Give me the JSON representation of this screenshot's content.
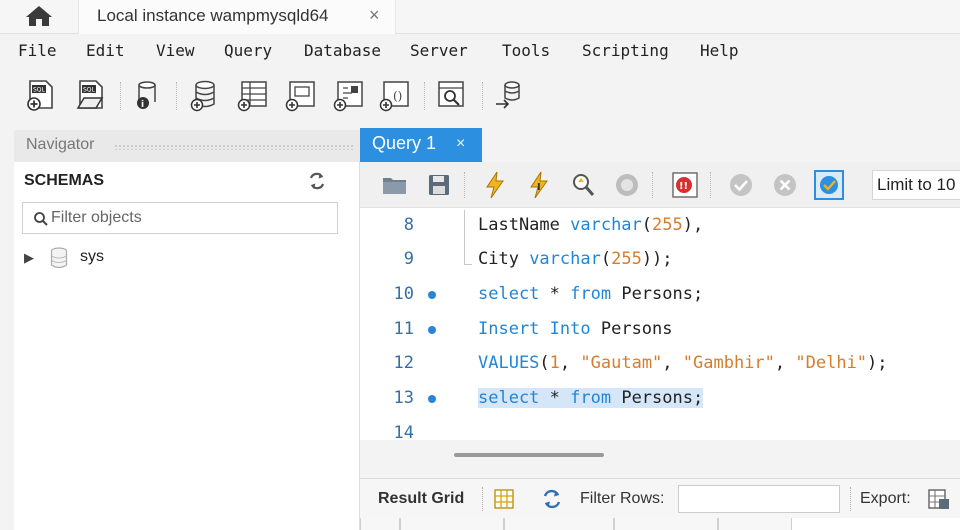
{
  "connection_tab": {
    "title": "Local instance wampmysqld64",
    "close": "×"
  },
  "menu": [
    "File",
    "Edit",
    "View",
    "Query",
    "Database",
    "Server",
    "Tools",
    "Scripting",
    "Help"
  ],
  "navigator": {
    "title": "Navigator",
    "schemas_label": "SCHEMAS",
    "filter_placeholder": "Filter objects",
    "schemas": [
      {
        "name": "sys",
        "expanded": false
      }
    ]
  },
  "query_tab": {
    "label": "Query 1",
    "close": "×"
  },
  "query_toolbar": {
    "limit_label": "Limit to 10"
  },
  "editor": {
    "lines": [
      {
        "n": "8",
        "text": "LastName varchar(255),",
        "breakpoint": false,
        "selected": false
      },
      {
        "n": "9",
        "text": "City varchar(255));",
        "breakpoint": false,
        "selected": false
      },
      {
        "n": "10",
        "text": "select * from Persons;",
        "breakpoint": true,
        "selected": false
      },
      {
        "n": "11",
        "text": "Insert Into Persons",
        "breakpoint": true,
        "selected": false
      },
      {
        "n": "12",
        "text": "VALUES(1, \"Gautam\", \"Gambhir\", \"Delhi\");",
        "breakpoint": false,
        "selected": false
      },
      {
        "n": "13",
        "text": "select * from Persons;",
        "breakpoint": true,
        "selected": true
      },
      {
        "n": "14",
        "text": "",
        "breakpoint": false,
        "selected": false
      }
    ]
  },
  "result_toolbar": {
    "result_grid_label": "Result Grid",
    "filter_rows_label": "Filter Rows:",
    "filter_rows_value": "",
    "export_label": "Export:"
  },
  "colors": {
    "accent": "#2d8fe0",
    "keyword": "#1f86d8",
    "literal": "#d67d2a",
    "line_number": "#356fa4",
    "selection": "#d4e6f8"
  }
}
